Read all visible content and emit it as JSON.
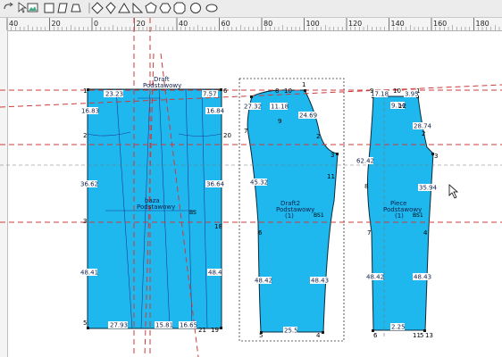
{
  "colors": {
    "piece_fill": "#1fb8ee",
    "guide_red": "#cc3b3b",
    "dark_line": "#1a1a1a",
    "blue_label": "#2247c9"
  },
  "toolbar": {
    "tools": [
      {
        "name": "undo-icon"
      },
      {
        "name": "cursor-icon"
      },
      {
        "name": "picture-icon"
      },
      {
        "name": "rectangle-tool-icon"
      },
      {
        "name": "parallelogram-tool-icon"
      },
      {
        "name": "trapezoid-tool-icon"
      },
      {
        "name": "separator-icon"
      },
      {
        "name": "rhombus-tool-icon"
      },
      {
        "name": "kite-tool-icon"
      },
      {
        "name": "triangle-tool-icon"
      },
      {
        "name": "right-triangle-tool-icon"
      },
      {
        "name": "pentagon-tool-icon"
      },
      {
        "name": "hexagon-tool-icon"
      },
      {
        "name": "octagon-tool-icon"
      },
      {
        "name": "circle-tool-icon"
      },
      {
        "name": "ellipse-tool-icon"
      }
    ]
  },
  "ruler_labels": [
    "40",
    "20",
    "0",
    "20",
    "40",
    "60",
    "80",
    "100",
    "120",
    "140",
    "160",
    "180"
  ],
  "pieces": {
    "baza": {
      "title": "baza",
      "subtitle": "Podstawowy",
      "bs": "BS",
      "header_label": "Draft",
      "header_sub": "Podstawowy",
      "measurements": [
        "23.23",
        "16.83",
        "36.62",
        "48.41",
        "27.93",
        "7.57",
        "16.84",
        "36.64",
        "48.4",
        "15.81",
        "16.65"
      ],
      "points": [
        "1",
        "2",
        "3",
        "5",
        "6",
        "18",
        "19",
        "20",
        "21"
      ]
    },
    "draft2": {
      "title": "Draft2",
      "subtitle": "Podstawowy",
      "qty": "(1)",
      "bs": "BS1",
      "measurements": [
        "27.32",
        "11.18",
        "24.69",
        "45.32",
        "48.42",
        "48.43",
        "25.5"
      ],
      "points": [
        "1",
        "2",
        "3",
        "4",
        "5",
        "6",
        "7",
        "8",
        "9",
        "10",
        "11"
      ]
    },
    "piece": {
      "title": "Piece",
      "subtitle": "Podstawowy",
      "qty": "(1)",
      "bs": "BS1",
      "measurements": [
        "17.18",
        "3.95",
        "9.14",
        "28.74",
        "62.42",
        "35.94",
        "48.42",
        "48.43",
        "2.25"
      ],
      "points": [
        "1",
        "2",
        "3",
        "4",
        "5",
        "6",
        "7",
        "8",
        "9",
        "10",
        "11",
        "12",
        "13"
      ]
    }
  }
}
